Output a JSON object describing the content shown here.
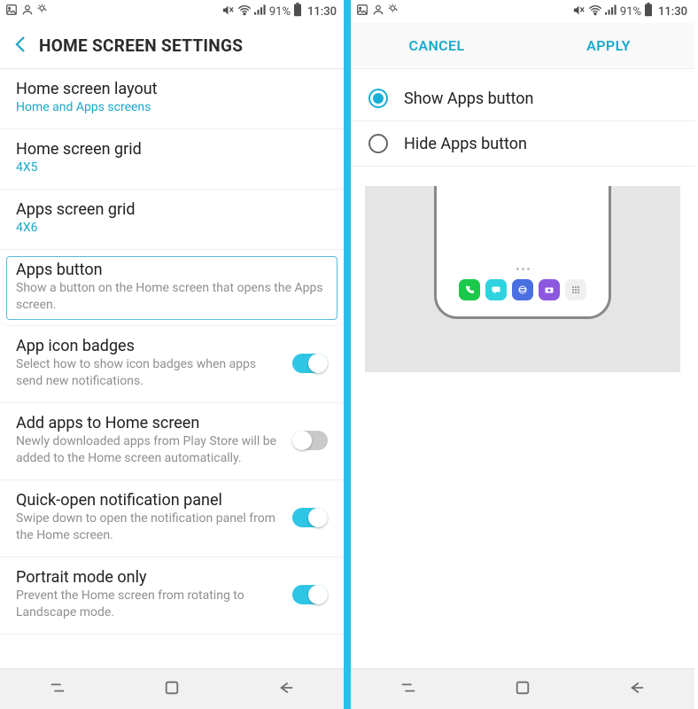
{
  "status": {
    "battery_pct": "91%",
    "time": "11:30"
  },
  "left": {
    "title": "HOME SCREEN SETTINGS",
    "rows": {
      "layout": {
        "title": "Home screen layout",
        "sub": "Home and Apps screens"
      },
      "homegrid": {
        "title": "Home screen grid",
        "sub": "4X5"
      },
      "appsgrid": {
        "title": "Apps screen grid",
        "sub": "4X6"
      },
      "appsbtn": {
        "title": "Apps button",
        "sub": "Show a button on the Home screen that opens the Apps screen."
      },
      "badges": {
        "title": "App icon badges",
        "sub": "Select how to show icon badges when apps send new notifications."
      },
      "addapps": {
        "title": "Add apps to Home screen",
        "sub": "Newly downloaded apps from Play Store will be added to the Home screen automatically."
      },
      "quickpanel": {
        "title": "Quick-open notification panel",
        "sub": "Swipe down to open the notification panel from the Home screen."
      },
      "portrait": {
        "title": "Portrait mode only",
        "sub": "Prevent the Home screen from rotating to Landscape mode."
      }
    }
  },
  "right": {
    "cancel": "CANCEL",
    "apply": "APPLY",
    "option_show": "Show Apps button",
    "option_hide": "Hide Apps button"
  }
}
